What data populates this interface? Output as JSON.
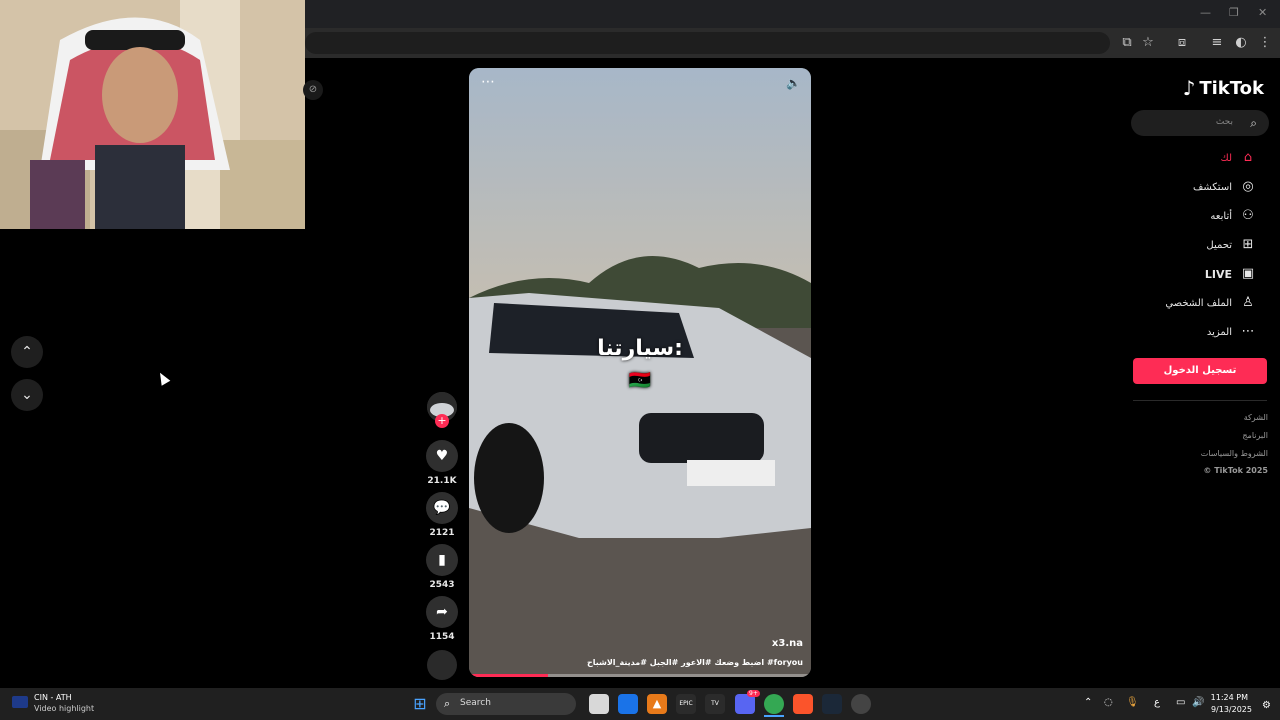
{
  "browser": {
    "window_controls": {
      "minimize": "—",
      "restore": "❐",
      "close": "✕"
    }
  },
  "tiktok": {
    "logo_text": "TikTok",
    "search_placeholder": "بحث",
    "nav": [
      {
        "label": "لك",
        "icon": "home-icon",
        "active": true
      },
      {
        "label": "استكشف",
        "icon": "compass-icon"
      },
      {
        "label": "أتابعه",
        "icon": "user-follow-icon"
      },
      {
        "label": "تحميل",
        "icon": "upload-icon"
      },
      {
        "label": "LIVE",
        "icon": "live-icon"
      },
      {
        "label": "الملف الشخصي",
        "icon": "profile-icon"
      },
      {
        "label": "المزيد",
        "icon": "more-icon"
      }
    ],
    "login_button": "تسجيل الدخول",
    "footer": [
      "الشركة",
      "البرنامج",
      "الشروط والسياسات",
      "© TikTok 2025"
    ],
    "accent": "#fe2c55"
  },
  "video": {
    "overlay_text": "سيارتنا:",
    "flag": "🇱🇾",
    "username": "x3.na",
    "hashtags": "اضبط وضعك  #الاعور  #الجبل  #مدينة_الاشباح  #foryou",
    "progress_percent": 23
  },
  "actions": {
    "likes": "21.1K",
    "comments": "2121",
    "saves": "2543",
    "shares": "1154"
  },
  "taskbar": {
    "weather_location": "CIN - ATH",
    "weather_subtitle": "Video highlight",
    "search_label": "Search",
    "time": "11:24 PM",
    "date": "9/13/2025",
    "lang": "ع",
    "discord_badge": "9+"
  }
}
